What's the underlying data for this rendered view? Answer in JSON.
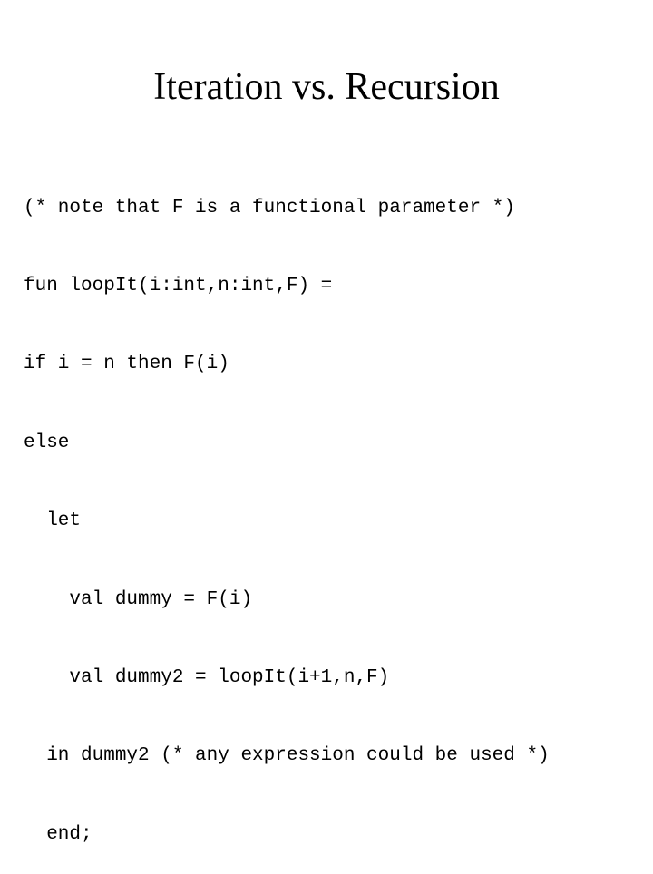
{
  "slide": {
    "title": "Iteration vs. Recursion",
    "code_lines": [
      "(* note that F is a functional parameter *)",
      "fun loopIt(i:int,n:int,F) =",
      "if i = n then F(i)",
      "else",
      "  let",
      "    val dummy = F(i)",
      "    val dummy2 = loopIt(i+1,n,F)",
      "  in dummy2 (* any expression could be used *)",
      "  end;"
    ]
  }
}
